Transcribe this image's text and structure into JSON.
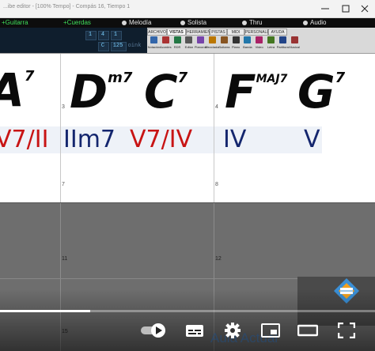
{
  "window": {
    "title": "...ibe editor - [100% Tempo] - Compás 16, Tiempo 1"
  },
  "tracks": [
    {
      "name": "Guitarra",
      "state": "on"
    },
    {
      "name": "Cuerdas",
      "state": "on"
    },
    {
      "name": "Melodía",
      "state": "normal"
    },
    {
      "name": "Solista",
      "state": "normal"
    },
    {
      "name": "Thru",
      "state": "normal"
    },
    {
      "name": "Audio",
      "state": "normal"
    }
  ],
  "transport": {
    "position": [
      "1",
      "4",
      "1"
    ],
    "key": "C",
    "tempo": "125",
    "extra": "oink"
  },
  "view_tabs": [
    {
      "label": "ARCHIVO",
      "active": false
    },
    {
      "label": "VISTAS",
      "active": true
    },
    {
      "label": "HERRAMIENTAS",
      "active": false
    },
    {
      "label": "PISTAS",
      "active": false
    },
    {
      "label": "MIDI",
      "active": false
    },
    {
      "label": "PERSONALIZAR",
      "active": false
    },
    {
      "label": "AYUDA",
      "active": false
    }
  ],
  "tools": [
    {
      "label": "Notación",
      "icon": "notation-icon"
    },
    {
      "label": "Acordes",
      "icon": "chords-icon"
    },
    {
      "label": "RDR",
      "icon": "rdr-icon"
    },
    {
      "label": "Editar",
      "icon": "edit-icon"
    },
    {
      "label": "Pianoroll",
      "icon": "pianoroll-icon"
    },
    {
      "label": "Mezclador",
      "icon": "mixer-icon"
    },
    {
      "label": "Guitarra",
      "icon": "guitar-icon"
    },
    {
      "label": "Piano",
      "icon": "piano-icon"
    },
    {
      "label": "Banda",
      "icon": "band-icon"
    },
    {
      "label": "Video",
      "icon": "video-icon"
    },
    {
      "label": "Letra",
      "icon": "lyrics-icon"
    },
    {
      "label": "Partitura",
      "icon": "score-icon"
    },
    {
      "label": "Musical",
      "icon": "musical-icon"
    }
  ],
  "bars": [
    {
      "number": "",
      "chords": [
        {
          "root": "A",
          "ext": "7"
        }
      ],
      "roman": "V7/II",
      "roman_color": "red"
    },
    {
      "number": "3",
      "chords": [
        {
          "root": "D",
          "ext": "m7"
        },
        {
          "root": "C",
          "ext": "7"
        }
      ],
      "romans": [
        {
          "text": "IIm7",
          "color": "blue"
        },
        {
          "text": "V7/IV",
          "color": "red"
        }
      ]
    },
    {
      "number": "4",
      "chords": [
        {
          "root": "F",
          "ext": "MAJ7"
        },
        {
          "root": "G",
          "ext": "7"
        }
      ],
      "romans": [
        {
          "text": "IV",
          "color": "blue"
        },
        {
          "text": "V",
          "color": "blue"
        }
      ]
    }
  ],
  "lower_bar_numbers": [
    "7",
    "11",
    "15"
  ],
  "video": {
    "progress": 0.24,
    "watermark": "Aula Actual",
    "controls": [
      "autoplay-toggle",
      "subtitles-icon",
      "settings-gear-icon",
      "miniplayer-icon",
      "theater-mode-icon",
      "fullscreen-icon"
    ]
  },
  "colors": {
    "roman_red": "#c81414",
    "roman_blue": "#14266e",
    "track_active": "#3fdf5b",
    "transport_text": "#7bd0ff"
  }
}
